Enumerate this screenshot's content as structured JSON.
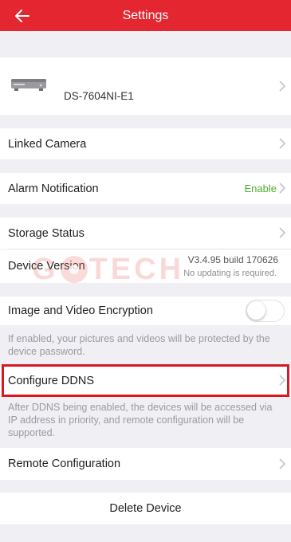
{
  "header": {
    "title": "Settings"
  },
  "device": {
    "name": "DS-7604NI-E1"
  },
  "linked_camera": {
    "label": "Linked Camera"
  },
  "alarm": {
    "label": "Alarm Notification",
    "value": "Enable"
  },
  "storage": {
    "label": "Storage Status"
  },
  "version": {
    "label": "Device Version",
    "value": "V3.4.95 build 170626",
    "status": "No updating is required."
  },
  "encryption": {
    "label": "Image and Video Encryption",
    "enabled": false,
    "note": "If enabled, your pictures and videos will be protected by the device password."
  },
  "ddns": {
    "label": "Configure DDNS",
    "note": "After DDNS being enabled, the devices will be accessed via IP address in priority, and remote configuration will be supported."
  },
  "remote": {
    "label": "Remote Configuration"
  },
  "delete": {
    "label": "Delete Device"
  },
  "watermark": {
    "text_left": "G",
    "text_right": "TECH"
  },
  "colors": {
    "header": "#e3262f",
    "enable": "#4caf2e",
    "highlight": "#d91920"
  }
}
